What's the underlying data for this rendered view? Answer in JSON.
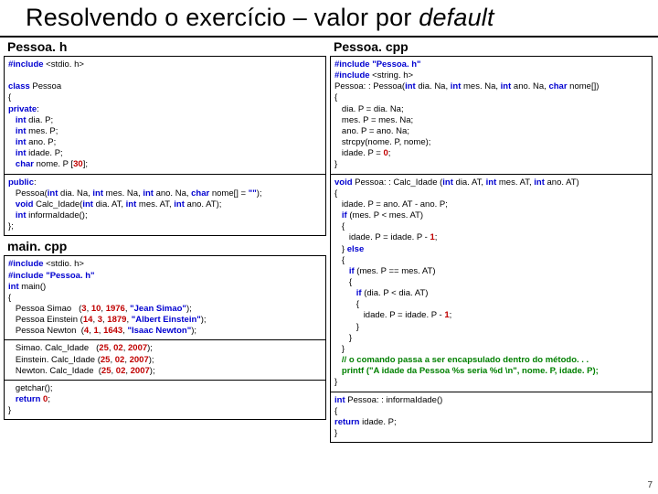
{
  "title_plain": "Resolvendo o exercício – valor por ",
  "title_ital": "default",
  "left": {
    "label1": "Pessoa. h",
    "box1a": "#include <stdio. h>\n\nclass Pessoa\n{\nprivate:\n   int dia. P;\n   int mes. P;\n   int ano. P;\n   int idade. P;\n   char nome. P [30];",
    "box1b": "public:\n   Pessoa(int dia. Na, int mes. Na, int ano. Na, char nome[] = \"\");\n   void Calc_Idade(int dia. AT, int mes. AT, int ano. AT);\n   int informaIdade();\n};",
    "label2": "main. cpp",
    "box2a": "#include <stdio. h>\n#include \"Pessoa. h\"\nint main()\n{\n   Pessoa Simao   (3, 10, 1976, \"Jean Simao\");\n   Pessoa Einstein (14, 3, 1879, \"Albert Einstein\");\n   Pessoa Newton  (4, 1, 1643, \"Isaac Newton\");",
    "box2b": "   Simao. Calc_Idade   (25, 02, 2007);\n   Einstein. Calc_Idade (25, 02, 2007);\n   Newton. Calc_Idade  (25, 02, 2007);",
    "box2c": "   getchar();\n   return 0;\n}"
  },
  "right": {
    "label1": "Pessoa. cpp",
    "box1a": "#include \"Pessoa. h\"\n#include <string. h>\nPessoa: : Pessoa(int dia. Na, int mes. Na, int ano. Na, char nome[])\n{\n   dia. P = dia. Na;\n   mes. P = mes. Na;\n   ano. P = ano. Na;\n   strcpy(nome. P, nome);\n   idade. P = 0;\n}",
    "box1b": "void Pessoa: : Calc_Idade (int dia. AT, int mes. AT, int ano. AT)\n{\n   idade. P = ano. AT - ano. P;\n   if (mes. P &lt; mes. AT)\n   {\n      idade. P = idade. P - 1;\n   } else\n   {\n      if (mes. P == mes. AT)\n      {\n         if (dia. P &lt; dia. AT)\n         {\n            idade. P = idade. P - 1;\n         }\n      }\n   }\n   // o comando passa a ser encapsulado dentro do método. . .\n   printf (\"A idade da Pessoa %s seria %d \\n\", nome. P, idade. P);\n}",
    "box1c": "int Pessoa: : informaIdade()\n{\nreturn idade. P;\n}"
  },
  "page_num": "7"
}
